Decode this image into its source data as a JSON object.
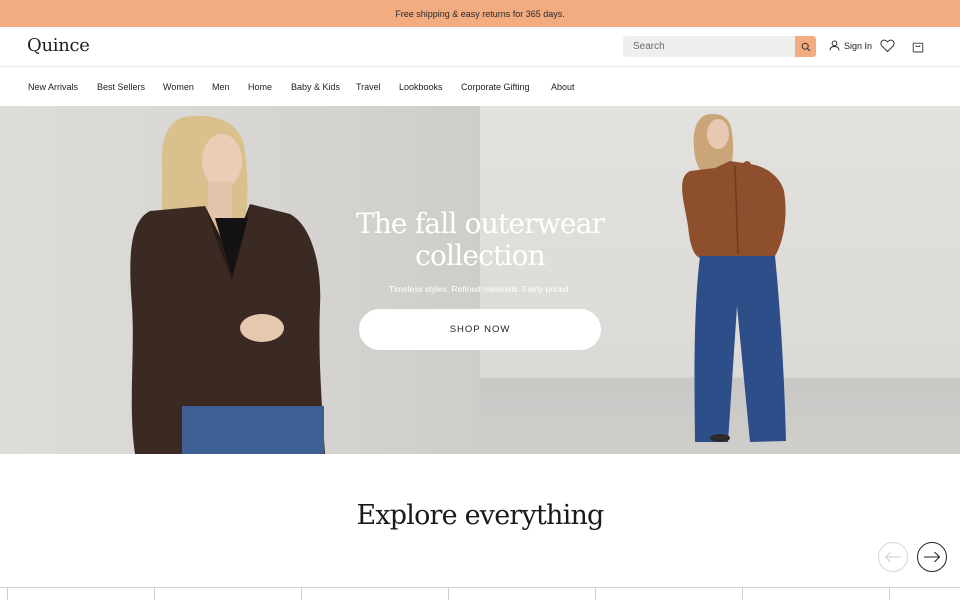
{
  "promo": {
    "text": "Free shipping & easy returns for 365 days."
  },
  "header": {
    "logo": "Quince",
    "search_placeholder": "Search",
    "sign_in_label": "Sign In",
    "icons": {
      "search": "search-icon",
      "account": "user-icon",
      "wishlist": "heart-icon",
      "cart": "bag-icon"
    }
  },
  "nav": {
    "items": [
      {
        "label": "New Arrivals"
      },
      {
        "label": "Best Sellers"
      },
      {
        "label": "Women"
      },
      {
        "label": "Men"
      },
      {
        "label": "Home"
      },
      {
        "label": "Baby & Kids"
      },
      {
        "label": "Travel"
      },
      {
        "label": "Lookbooks"
      },
      {
        "label": "Corporate Gifting"
      },
      {
        "label": "About"
      }
    ]
  },
  "hero": {
    "title_line1": "The fall outerwear",
    "title_line2": "collection",
    "subtitle": "Timeless styles. Refined materials. Fairly priced.",
    "cta_label": "SHOP NOW"
  },
  "explore": {
    "title": "Explore everything",
    "prev_icon": "arrow-left-icon",
    "next_icon": "arrow-right-icon"
  },
  "colors": {
    "accent": "#f3ab80",
    "text": "#222222",
    "hero_text": "#ffffff"
  }
}
